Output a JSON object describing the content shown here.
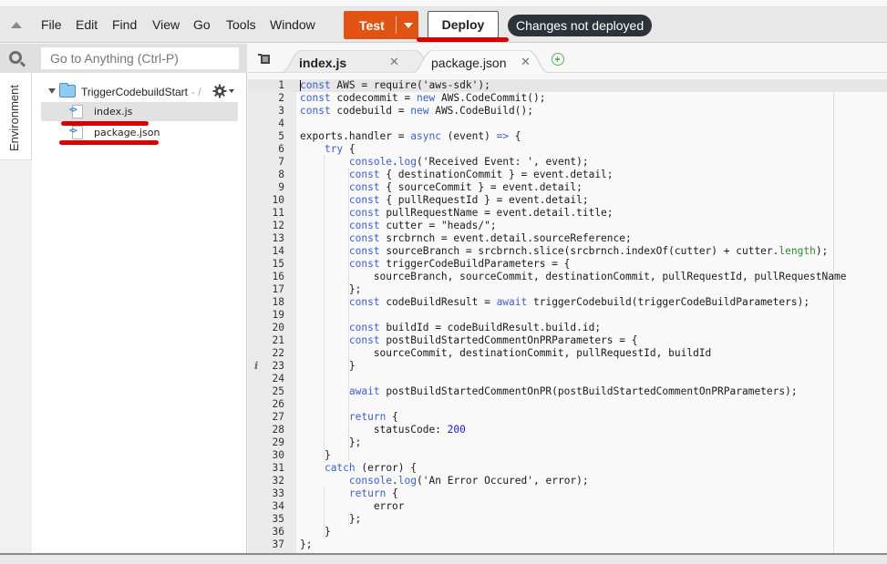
{
  "menubar": {
    "items": [
      "File",
      "Edit",
      "Find",
      "View",
      "Go",
      "Tools",
      "Window"
    ],
    "test_label": "Test",
    "deploy_label": "Deploy",
    "status": "Changes not deployed"
  },
  "colors": {
    "accent_orange": "#e05313",
    "annotation_red": "#d60000",
    "status_bg": "#2c333a"
  },
  "sidebar": {
    "search_placeholder": "Go to Anything (Ctrl-P)",
    "environment_tab": "Environment",
    "root_folder": "TriggerCodebuildStart",
    "root_suffix": "- /",
    "files": [
      "index.js",
      "package.json"
    ]
  },
  "tabs": [
    {
      "label": "index.js",
      "active": true
    },
    {
      "label": "package.json",
      "active": false
    }
  ],
  "editor": {
    "active_line": 1,
    "info_line": 23,
    "lines": [
      "const AWS = require('aws-sdk');",
      "const codecommit = new AWS.CodeCommit();",
      "const codebuild = new AWS.CodeBuild();",
      "",
      "exports.handler = async (event) => {",
      "    try {",
      "        console.log('Received Event: ', event);",
      "        const { destinationCommit } = event.detail;",
      "        const { sourceCommit } = event.detail;",
      "        const { pullRequestId } = event.detail;",
      "        const pullRequestName = event.detail.title;",
      "        const cutter = \"heads/\";",
      "        const srcbrnch = event.detail.sourceReference;",
      "        const sourceBranch = srcbrnch.slice(srcbrnch.indexOf(cutter) + cutter.length);",
      "        const triggerCodeBuildParameters = {",
      "            sourceBranch, sourceCommit, destinationCommit, pullRequestId, pullRequestName",
      "        };",
      "        const codeBuildResult = await triggerCodebuild(triggerCodeBuildParameters);",
      "",
      "        const buildId = codeBuildResult.build.id;",
      "        const postBuildStartedCommentOnPRParameters = {",
      "            sourceCommit, destinationCommit, pullRequestId, buildId",
      "        }",
      "",
      "        await postBuildStartedCommentOnPR(postBuildStartedCommentOnPRParameters);",
      "",
      "        return {",
      "            statusCode: 200",
      "        };",
      "    }",
      "    catch (error) {",
      "        console.log('An Error Occured', error);",
      "        return {",
      "            error",
      "        };",
      "    }",
      "};"
    ]
  }
}
